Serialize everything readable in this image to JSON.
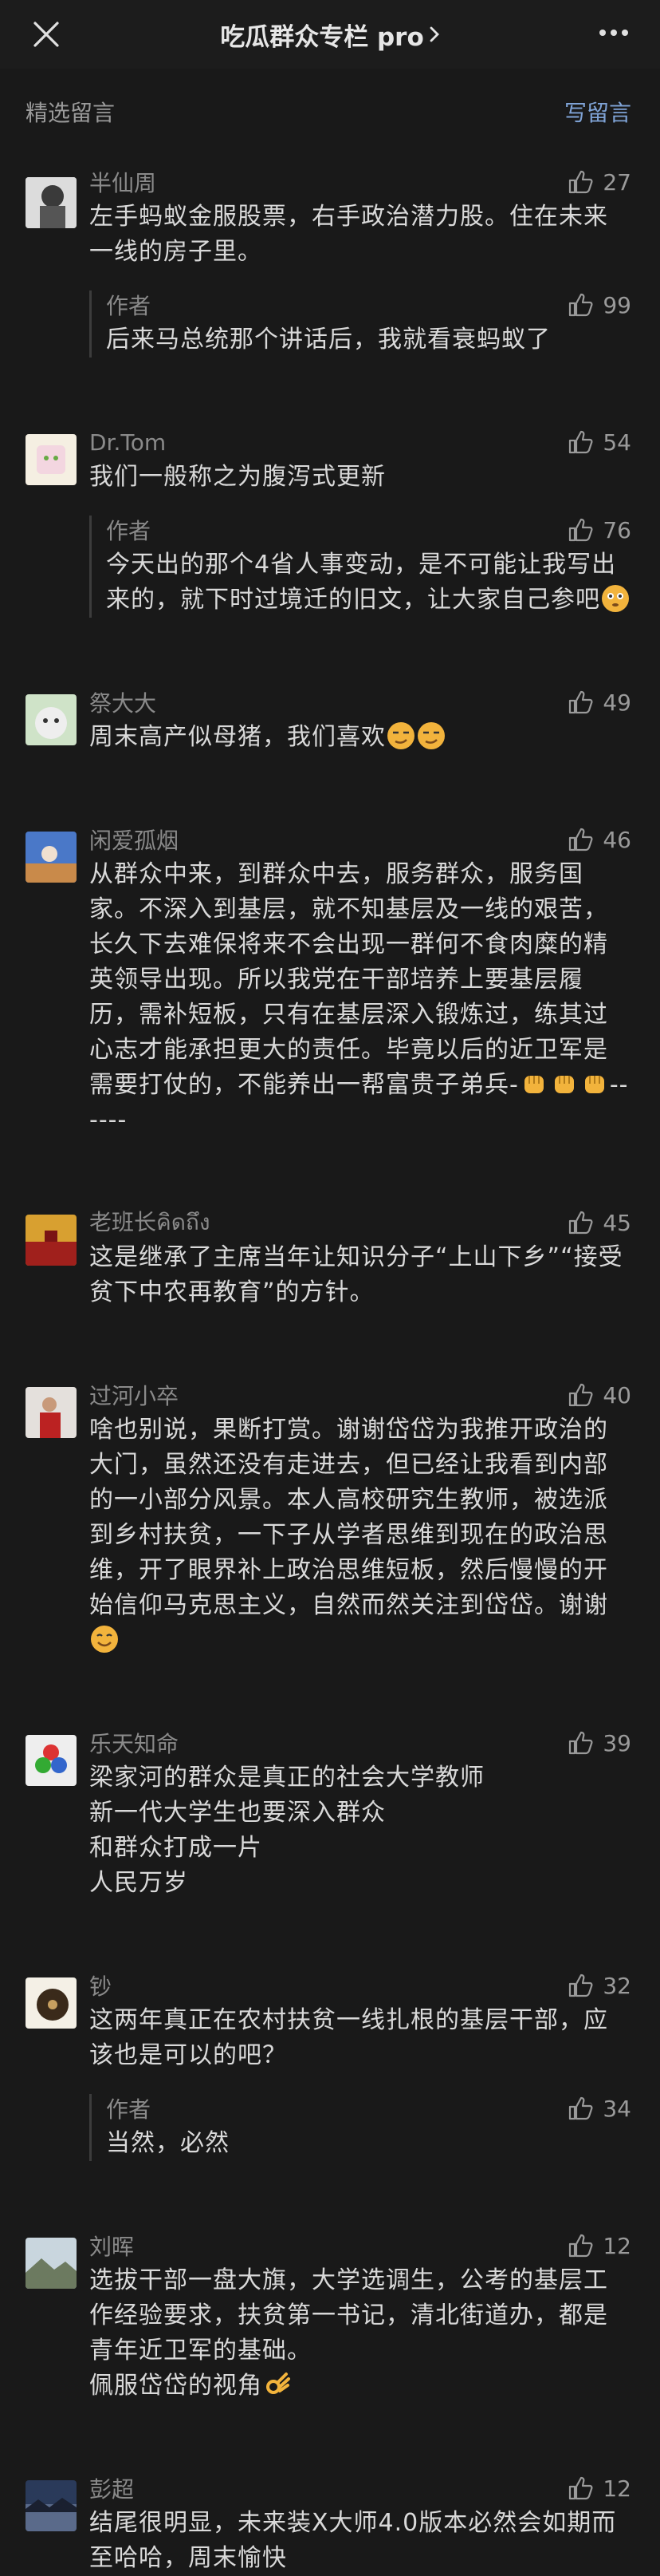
{
  "header": {
    "title": "吃瓜群众专栏 pro"
  },
  "section": {
    "label": "精选留言",
    "write_label": "写留言"
  },
  "comments": [
    {
      "name": "半仙周",
      "likes": "27",
      "text": "左手蚂蚁金服股票，右手政治潜力股。住在未来一线的房子里。",
      "reply": {
        "name": "作者",
        "likes": "99",
        "text": "后来马总统那个讲话后，我就看衰蚂蚁了"
      }
    },
    {
      "name": "Dr.Tom",
      "likes": "54",
      "text": "我们一般称之为腹泻式更新",
      "reply": {
        "name": "作者",
        "likes": "76",
        "text": "今天出的那个4省人事变动，是不可能让我写出来的，就下时过境迁的旧文，让大家自己参吧"
      }
    },
    {
      "name": "祭大大",
      "likes": "49",
      "text": "周末高产似母猪，我们喜欢"
    },
    {
      "name": "闲爱孤烟",
      "likes": "46",
      "text": "从群众中来，到群众中去，服务群众，服务国家。不深入到基层，就不知基层及一线的艰苦，长久下去难保将来不会出现一群何不食肉糜的精英领导出现。所以我党在干部培养上要基层履历，需补短板，只有在基层深入锻炼过，练其过心志才能承担更大的责任。毕竟以后的近卫军是需要打仗的，不能养出一帮富贵子弟兵-",
      "tail": "------"
    },
    {
      "name": "老班长คิดถึง",
      "likes": "45",
      "text": "这是继承了主席当年让知识分子“上山下乡”“接受贫下中农再教育”的方针。"
    },
    {
      "name": "过河小卒",
      "likes": "40",
      "text": "啥也别说，果断打赏。谢谢岱岱为我推开政治的大门，虽然还没有走进去，但已经让我看到内部的一小部分风景。本人高校研究生教师，被选派到乡村扶贫，一下子从学者思维到现在的政治思维，开了眼界补上政治思维短板，然后慢慢的开始信仰马克思主义，自然而然关注到岱岱。谢谢"
    },
    {
      "name": "乐天知命",
      "likes": "39",
      "lines": [
        "梁家河的群众是真正的社会大学教师",
        "新一代大学生也要深入群众",
        "和群众打成一片",
        "人民万岁"
      ]
    },
    {
      "name": "钞",
      "likes": "32",
      "text": "这两年真正在农村扶贫一线扎根的基层干部，应该也是可以的吧？",
      "reply": {
        "name": "作者",
        "likes": "34",
        "text": "当然，必然"
      }
    },
    {
      "name": "刘晖",
      "likes": "12",
      "text": "选拔干部一盘大旗，大学选调生，公考的基层工作经验要求，扶贫第一书记，清北街道办，都是青年近卫军的基础。",
      "line2": "佩服岱岱的视角"
    },
    {
      "name": "彭超",
      "likes": "12",
      "text": "结尾很明显，未来装X大师4.0版本必然会如期而至哈哈，周末愉快"
    }
  ],
  "icons": {
    "close": "close-icon",
    "more": "more-icon",
    "like": "thumbs-up-icon",
    "chevron": "chevron-right-icon"
  },
  "colors": {
    "bg": "#191919",
    "text": "#d9d9d9",
    "muted": "#8a8a8a",
    "link": "#7fa3d6",
    "emoji": "#f2b33c"
  }
}
